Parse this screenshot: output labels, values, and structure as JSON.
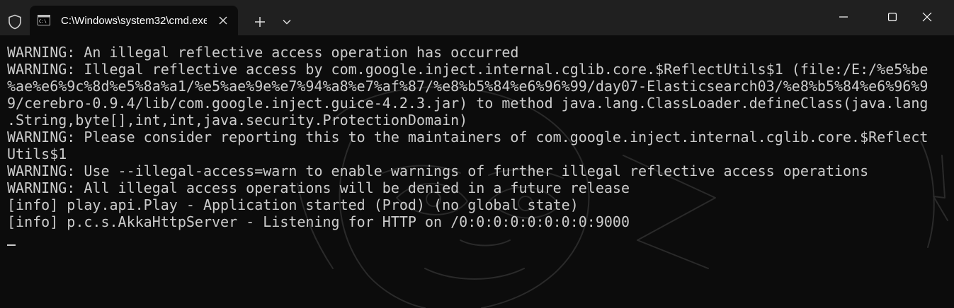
{
  "window": {
    "tab_title": "C:\\Windows\\system32\\cmd.exe",
    "icons": {
      "shield": "shield-icon",
      "tab": "cmd-prompt-icon",
      "close_tab": "close-icon",
      "new_tab": "plus-icon",
      "dropdown": "chevron-down-icon",
      "minimize": "minimize-icon",
      "maximize": "maximize-icon",
      "close_window": "close-icon"
    }
  },
  "terminal": {
    "lines": [
      "WARNING: An illegal reflective access operation has occurred",
      "WARNING: Illegal reflective access by com.google.inject.internal.cglib.core.$ReflectUtils$1 (file:/E:/%e5%be",
      "%ae%e6%9c%8d%e5%8a%a1/%e5%ae%9e%e7%94%a8%e7%af%87/%e8%b5%84%e6%96%99/day07-Elasticsearch03/%e8%b5%84%e6%96%9",
      "9/cerebro-0.9.4/lib/com.google.inject.guice-4.2.3.jar) to method java.lang.ClassLoader.defineClass(java.lang",
      ".String,byte[],int,int,java.security.ProtectionDomain)",
      "WARNING: Please consider reporting this to the maintainers of com.google.inject.internal.cglib.core.$Reflect",
      "Utils$1",
      "WARNING: Use --illegal-access=warn to enable warnings of further illegal reflective access operations",
      "WARNING: All illegal access operations will be denied in a future release",
      "[info] play.api.Play - Application started (Prod) (no global state)",
      "[info] p.c.s.AkkaHttpServer - Listening for HTTP on /0:0:0:0:0:0:0:0:9000"
    ],
    "colors": {
      "background": "#0c0c0c",
      "foreground": "#cccccc",
      "titlebar": "#202020"
    }
  }
}
